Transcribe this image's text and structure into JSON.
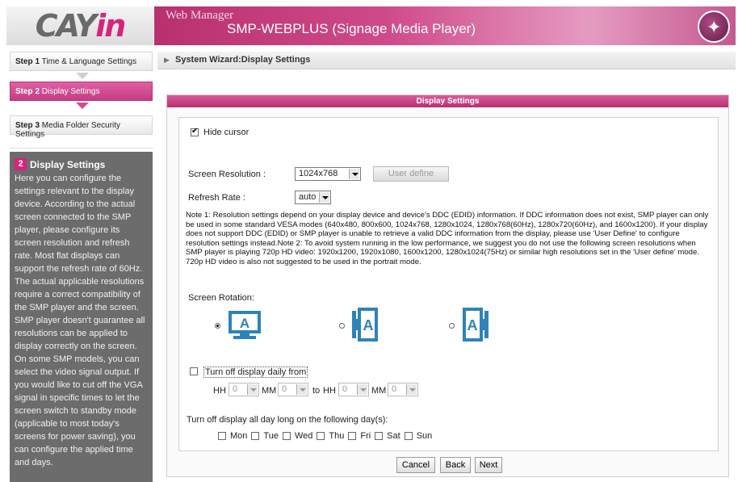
{
  "logo": {
    "brand_text_a": "CAY",
    "brand_text_b": "in"
  },
  "header": {
    "app_title": "Web Manager",
    "device_title": "SMP-WEBPLUS (Signage Media Player)"
  },
  "sidebar": {
    "steps": [
      {
        "num": "Step 1",
        "label": "Time & Language Settings",
        "active": false
      },
      {
        "num": "Step 2",
        "label": "Display Settings",
        "active": true
      },
      {
        "num": "Step 3",
        "label": "Media Folder Security Settings",
        "active": false
      }
    ],
    "help": {
      "number": "2",
      "title": "Display Settings",
      "body": "Here you can configure the settings relevant to the display device. According to the actual screen connected to the SMP player, please configure its screen resolution and refresh rate. Most flat displays can support the refresh rate of 60Hz. The actual applicable resolutions require a correct compatibility of the SMP player and the screen. SMP player doesn't guarantee all resolutions can be applied to display correctly on the screen. On some SMP models, you can select the video signal output. If you would like to cut off the VGA signal in specific times to let the screen switch to standby mode (applicable to most today's screens for power saving), you can configure the applied time and days."
    }
  },
  "breadcrumb": "System Wizard:Display Settings",
  "panel": {
    "title": "Display Settings",
    "hide_cursor": {
      "label": "Hide cursor",
      "checked": true
    },
    "screen_resolution": {
      "label": "Screen Resolution :",
      "value": "1024x768",
      "user_define_label": "User define"
    },
    "refresh_rate": {
      "label": "Refresh Rate :",
      "value": "auto"
    },
    "note": "Note 1: Resolution settings depend on your display device and device's DDC (EDID) information. If DDC information does not exist, SMP player can only be used in some standard VESA modes (640x480, 800x600, 1024x768, 1280x1024, 1280x768(60Hz), 1280x720(60Hz), and 1600x1200). If your display does not support DDC (EDID) or SMP player is unable to retrieve a valid DDC information from the display, please use 'User Define' to configure resolution settings instead.Note 2: To avoid system running in the low performance, we suggest you do not use the following screen resolutions when SMP player is playing 720p HD video: 1920x1200, 1920x1080, 1600x1200, 1280x1024(75Hz) or similar high resolutions set in the 'User define' mode. 720p HD video is also not suggested to be used in the portrait mode.",
    "rotation": {
      "label": "Screen Rotation:",
      "options": [
        {
          "icon": "landscape-monitor-icon",
          "selected": true
        },
        {
          "icon": "portrait-left-monitor-icon",
          "selected": false
        },
        {
          "icon": "portrait-right-monitor-icon",
          "selected": false
        }
      ]
    },
    "turn_off_daily": {
      "label": "Turn off display daily from",
      "checked": false,
      "hh_label": "HH",
      "mm_label": "MM",
      "to_label": "to",
      "from_hh": "0",
      "from_mm": "0",
      "to_hh": "0",
      "to_mm": "0"
    },
    "turn_off_days": {
      "label": "Turn off display all day long on the following day(s):",
      "days": [
        "Mon",
        "Tue",
        "Wed",
        "Thu",
        "Fri",
        "Sat",
        "Sun"
      ]
    },
    "buttons": {
      "cancel": "Cancel",
      "back": "Back",
      "next": "Next"
    }
  }
}
